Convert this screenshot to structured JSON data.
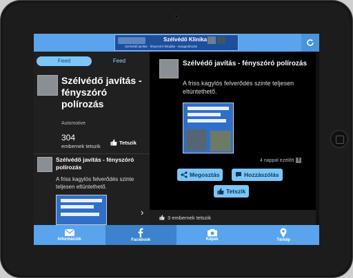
{
  "header": {
    "banner_title": "Szélvédő Klinika",
    "banner_subtitle": "Szélvédő javítás · fényszóró felújítás · üvegpolírozás"
  },
  "tabs": [
    {
      "label": "Feed",
      "active": true
    },
    {
      "label": "Feed",
      "active": false
    }
  ],
  "page": {
    "title": "Szélvédő javítás - fényszóró polírozás",
    "category": "Automotive",
    "likes_count": "304",
    "likes_label": "embernek tetszik",
    "like_button": "Tetszik"
  },
  "feed_post": {
    "title": "Szélvédő javítás - fényszóró polírozás",
    "text": "A friss kagylós felverődés szinte teljesen eltüntethető."
  },
  "post_detail": {
    "title": "Szélvédő javítás - fényszóró polírozás",
    "text": "A friss kagylós felverődés szinte teljesen eltüntethető.",
    "time": "4 nappal ezelőtt",
    "share_label": "Megosztás",
    "comment_label": "Hozzászólás",
    "like_label": "Tetszik",
    "likes_summary": "3 embernek tetszik"
  },
  "thumb_text": {
    "line1": "SZÉLVÉDŐ JAVÍTÁS",
    "line2": "FÉNYSZÓRÓ POLÍROZÁS",
    "phone": "+36 70 / 940 71 17"
  },
  "bottom_nav": [
    {
      "label": "Információk",
      "icon": "envelope-icon",
      "active": false
    },
    {
      "label": "Facebook",
      "icon": "facebook-icon",
      "active": true
    },
    {
      "label": "Képek",
      "icon": "camera-icon",
      "active": false
    },
    {
      "label": "Térkép",
      "icon": "map-pin-icon",
      "active": false
    }
  ],
  "colors": {
    "accent": "#59a4ec",
    "button": "#7cc6f7",
    "background": "#000000"
  }
}
